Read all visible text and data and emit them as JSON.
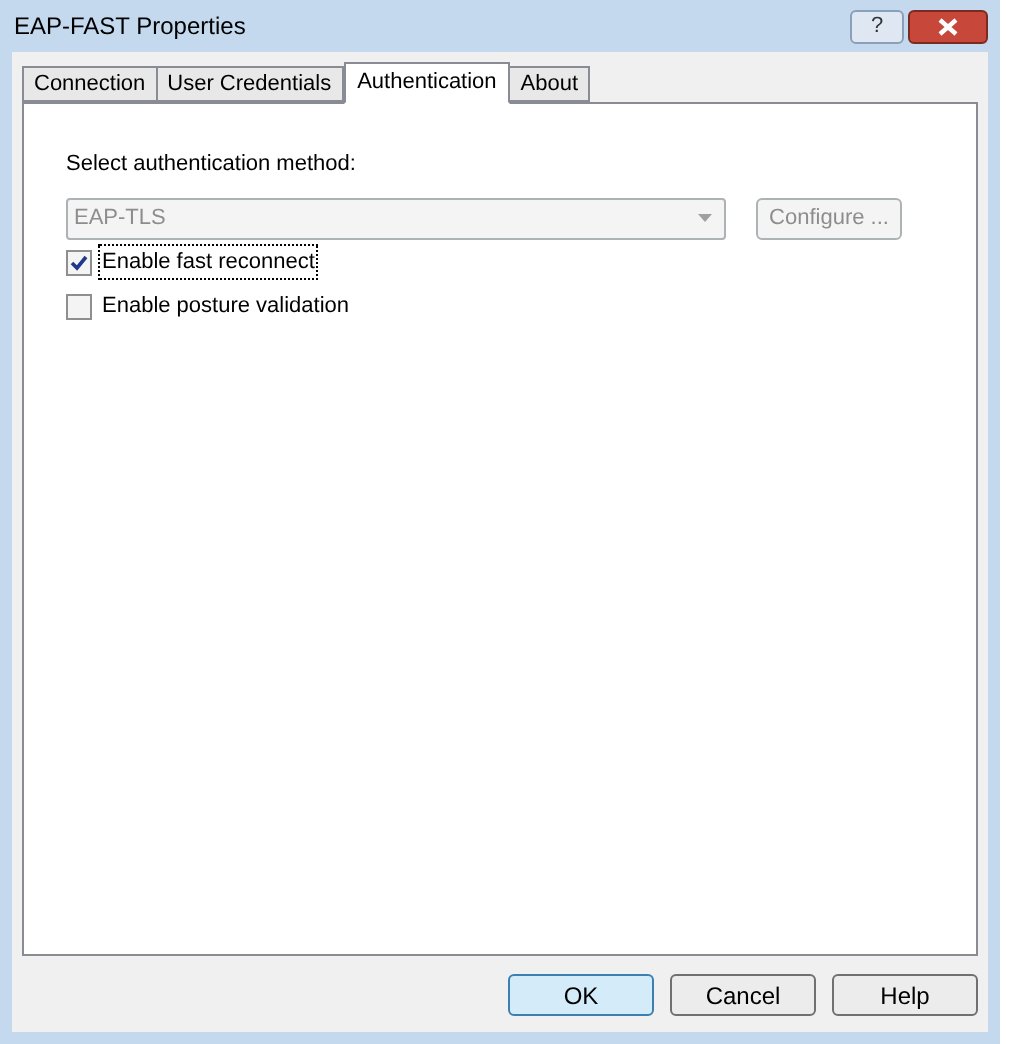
{
  "window": {
    "title": "EAP-FAST Properties",
    "help_button": "?"
  },
  "tabs": [
    {
      "label": "Connection",
      "selected": false
    },
    {
      "label": "User Credentials",
      "selected": false
    },
    {
      "label": "Authentication",
      "selected": true
    },
    {
      "label": "About",
      "selected": false
    }
  ],
  "method": {
    "label": "Select authentication method:",
    "value": "EAP-TLS",
    "disabled": true,
    "configure_button": "Configure ...",
    "configure_disabled": true
  },
  "options": [
    {
      "label": "Enable fast reconnect",
      "checked": true,
      "focused": true
    },
    {
      "label": "Enable posture validation",
      "checked": false,
      "focused": false
    }
  ],
  "buttons": [
    {
      "label": "OK",
      "default": true
    },
    {
      "label": "Cancel",
      "default": false
    },
    {
      "label": "Help",
      "default": false
    }
  ]
}
